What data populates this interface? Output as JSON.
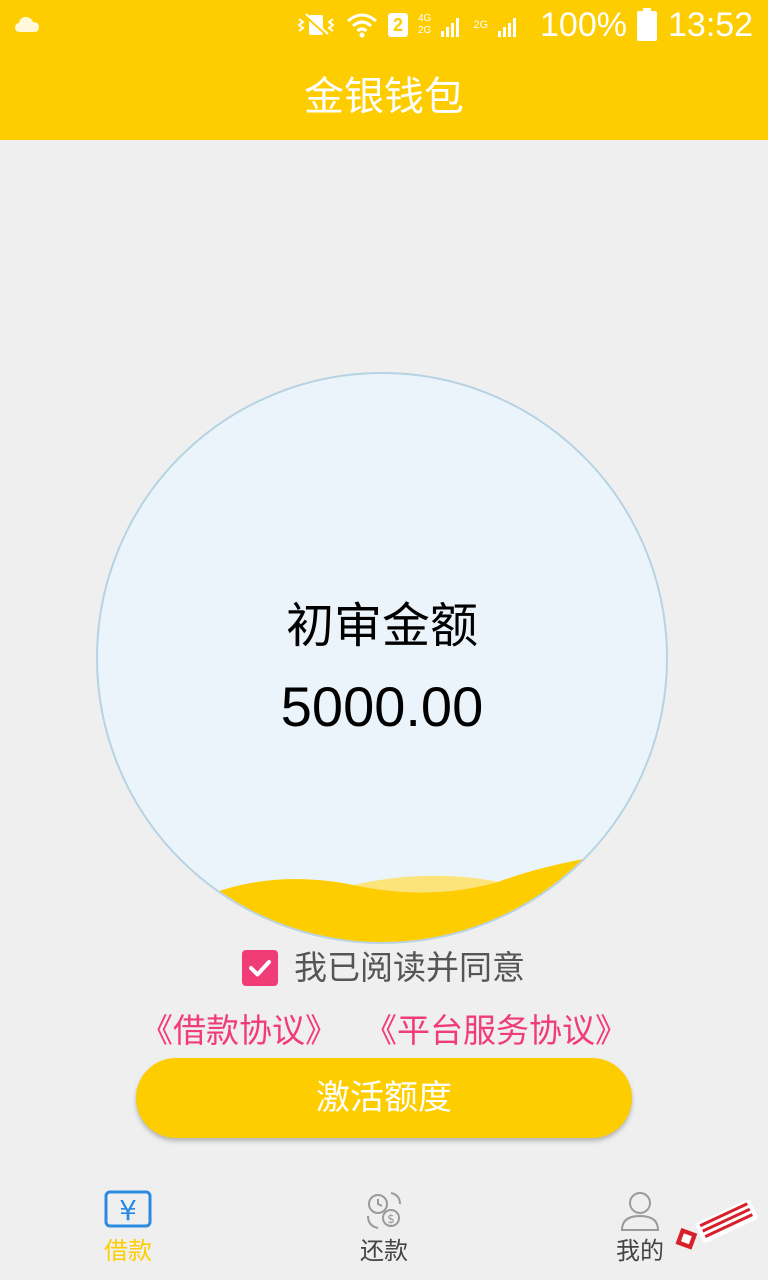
{
  "status_bar": {
    "battery": "100%",
    "time": "13:52",
    "sim_slot": "2",
    "network_top": "4G",
    "network_bottom": "2G",
    "network_second": "2G"
  },
  "header": {
    "title": "金银钱包"
  },
  "quota": {
    "label": "初审金额",
    "amount": "5000.00",
    "wave_color": "#fecd00"
  },
  "agreement": {
    "checked": true,
    "text": "我已阅读并同意",
    "loan_agreement": "《借款协议》",
    "platform_agreement": "《平台服务协议》"
  },
  "activate_button": {
    "label": "激活额度"
  },
  "bottom_nav": {
    "items": [
      {
        "label": "借款",
        "icon": "yuan-icon",
        "active": true
      },
      {
        "label": "还款",
        "icon": "repay-clock-icon",
        "active": false
      },
      {
        "label": "我的",
        "icon": "user-icon",
        "active": false
      }
    ]
  },
  "colors": {
    "brand": "#fecd00",
    "accent_pink": "#f03c77",
    "circle_fill": "#ecf4fb"
  }
}
